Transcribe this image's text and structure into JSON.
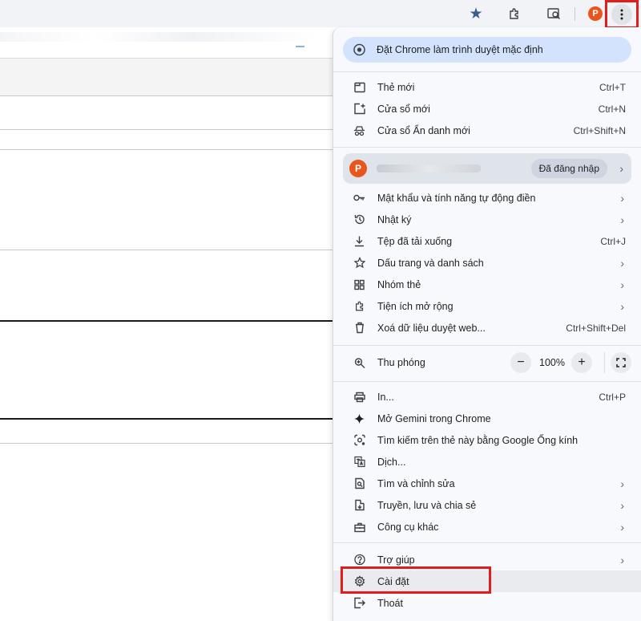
{
  "toolbar": {
    "profile_initial": "P",
    "icons": [
      "star-icon",
      "extensions-icon",
      "lens-search-icon",
      "more-menu-icon"
    ]
  },
  "menu": {
    "default_banner": "Đặt Chrome làm trình duyệt mặc định",
    "new_tab": {
      "label": "Thẻ mới",
      "shortcut": "Ctrl+T"
    },
    "new_window": {
      "label": "Cửa sổ mới",
      "shortcut": "Ctrl+N"
    },
    "incognito": {
      "label": "Cửa sổ Ẩn danh mới",
      "shortcut": "Ctrl+Shift+N"
    },
    "profile": {
      "initial": "P",
      "status": "Đã đăng nhập"
    },
    "passwords": {
      "label": "Mật khẩu và tính năng tự động điền"
    },
    "history": {
      "label": "Nhật ký"
    },
    "downloads": {
      "label": "Tệp đã tải xuống",
      "shortcut": "Ctrl+J"
    },
    "bookmarks": {
      "label": "Dấu trang và danh sách"
    },
    "tab_groups": {
      "label": "Nhóm thẻ"
    },
    "extensions": {
      "label": "Tiện ích mở rộng"
    },
    "clear_data": {
      "label": "Xoá dữ liệu duyệt web...",
      "shortcut": "Ctrl+Shift+Del"
    },
    "zoom": {
      "label": "Thu phóng",
      "minus": "−",
      "value": "100%",
      "plus": "+"
    },
    "print": {
      "label": "In...",
      "shortcut": "Ctrl+P"
    },
    "gemini": {
      "label": "Mở Gemini trong Chrome"
    },
    "lens": {
      "label": "Tìm kiếm trên thẻ này bằng Google Ống kính"
    },
    "translate": {
      "label": "Dịch..."
    },
    "find_edit": {
      "label": "Tìm và chỉnh sửa"
    },
    "cast_save": {
      "label": "Truyền, lưu và chia sẻ"
    },
    "more_tools": {
      "label": "Công cụ khác"
    },
    "help": {
      "label": "Trợ giúp"
    },
    "settings": {
      "label": "Cài đặt"
    },
    "exit": {
      "label": "Thoát"
    }
  },
  "colors": {
    "accent_banner": "#d3e3fd",
    "avatar": "#e8561c",
    "highlight_box": "#e01c1c",
    "star": "#3a5a92"
  }
}
